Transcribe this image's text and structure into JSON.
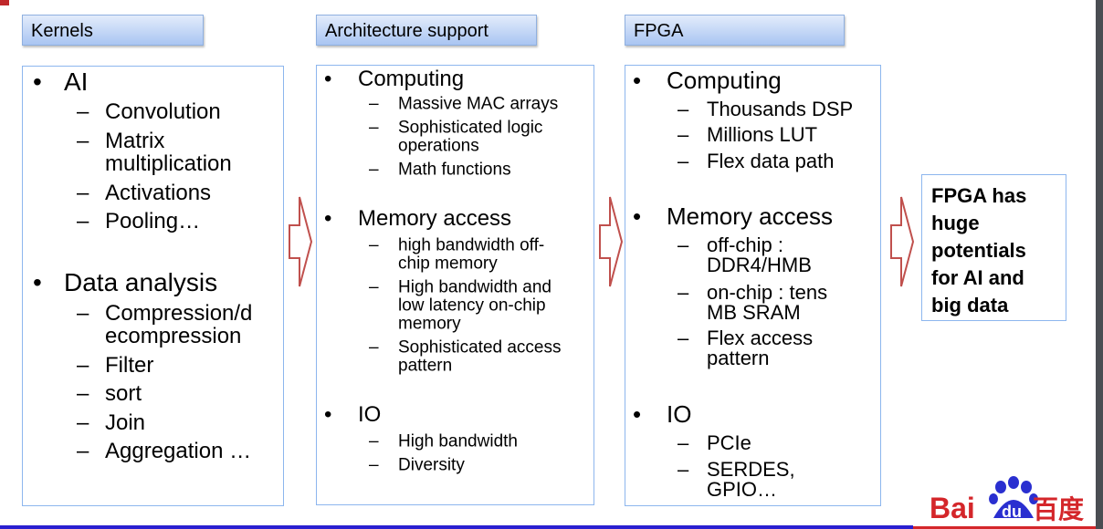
{
  "colors": {
    "header_top": "#e3ecfb",
    "header_bottom": "#a9c5f2",
    "box_border": "#8db6ee",
    "arrow": "#c0504d",
    "logo_red": "#d4262a",
    "logo_blue": "#2a2fd0"
  },
  "columns": [
    {
      "header": "Kernels",
      "items": [
        {
          "level": 1,
          "lines": [
            "AI"
          ]
        },
        {
          "level": 2,
          "lines": [
            "Convolution"
          ]
        },
        {
          "level": 2,
          "lines": [
            "Matrix",
            "multiplication"
          ]
        },
        {
          "level": 2,
          "lines": [
            "Activations"
          ]
        },
        {
          "level": 2,
          "lines": [
            "Pooling…"
          ]
        },
        {
          "level": 1,
          "lines": [
            "Data analysis"
          ]
        },
        {
          "level": 2,
          "lines": [
            "Compression/d",
            "ecompression"
          ]
        },
        {
          "level": 2,
          "lines": [
            "Filter"
          ]
        },
        {
          "level": 2,
          "lines": [
            "sort"
          ]
        },
        {
          "level": 2,
          "lines": [
            "Join"
          ]
        },
        {
          "level": 2,
          "lines": [
            "Aggregation …"
          ]
        }
      ]
    },
    {
      "header": "Architecture support",
      "items": [
        {
          "level": 1,
          "lines": [
            "Computing"
          ]
        },
        {
          "level": 2,
          "lines": [
            "Massive MAC arrays"
          ]
        },
        {
          "level": 2,
          "lines": [
            "Sophisticated logic",
            "operations"
          ]
        },
        {
          "level": 2,
          "lines": [
            "Math functions"
          ]
        },
        {
          "level": 1,
          "lines": [
            "Memory access"
          ]
        },
        {
          "level": 2,
          "lines": [
            "high bandwidth off-",
            "chip memory"
          ]
        },
        {
          "level": 2,
          "lines": [
            "High bandwidth and",
            "low latency on-chip",
            "memory"
          ]
        },
        {
          "level": 2,
          "lines": [
            "Sophisticated access",
            "pattern"
          ]
        },
        {
          "level": 1,
          "lines": [
            "IO"
          ]
        },
        {
          "level": 2,
          "lines": [
            "High bandwidth"
          ]
        },
        {
          "level": 2,
          "lines": [
            "Diversity"
          ]
        }
      ]
    },
    {
      "header": "FPGA",
      "items": [
        {
          "level": 1,
          "lines": [
            "Computing"
          ]
        },
        {
          "level": 2,
          "lines": [
            "Thousands DSP"
          ]
        },
        {
          "level": 2,
          "lines": [
            "Millions LUT"
          ]
        },
        {
          "level": 2,
          "lines": [
            "Flex data path"
          ]
        },
        {
          "level": 1,
          "lines": [
            "Memory access"
          ]
        },
        {
          "level": 2,
          "lines": [
            "off-chip :",
            "DDR4/HMB"
          ]
        },
        {
          "level": 2,
          "lines": [
            "on-chip : tens",
            "MB SRAM"
          ]
        },
        {
          "level": 2,
          "lines": [
            "Flex access",
            "pattern"
          ]
        },
        {
          "level": 1,
          "lines": [
            "IO"
          ]
        },
        {
          "level": 2,
          "lines": [
            "PCIe"
          ]
        },
        {
          "level": 2,
          "lines": [
            "SERDES,",
            "GPIO…"
          ]
        }
      ]
    }
  ],
  "conclusion": [
    "FPGA has",
    "huge",
    "potentials",
    "for AI and",
    "big data"
  ],
  "logo": {
    "text_latin": "Bai",
    "text_du": "du",
    "text_cn": "百度",
    "icon": "paw-icon"
  },
  "bullet": "•",
  "dash": "–"
}
